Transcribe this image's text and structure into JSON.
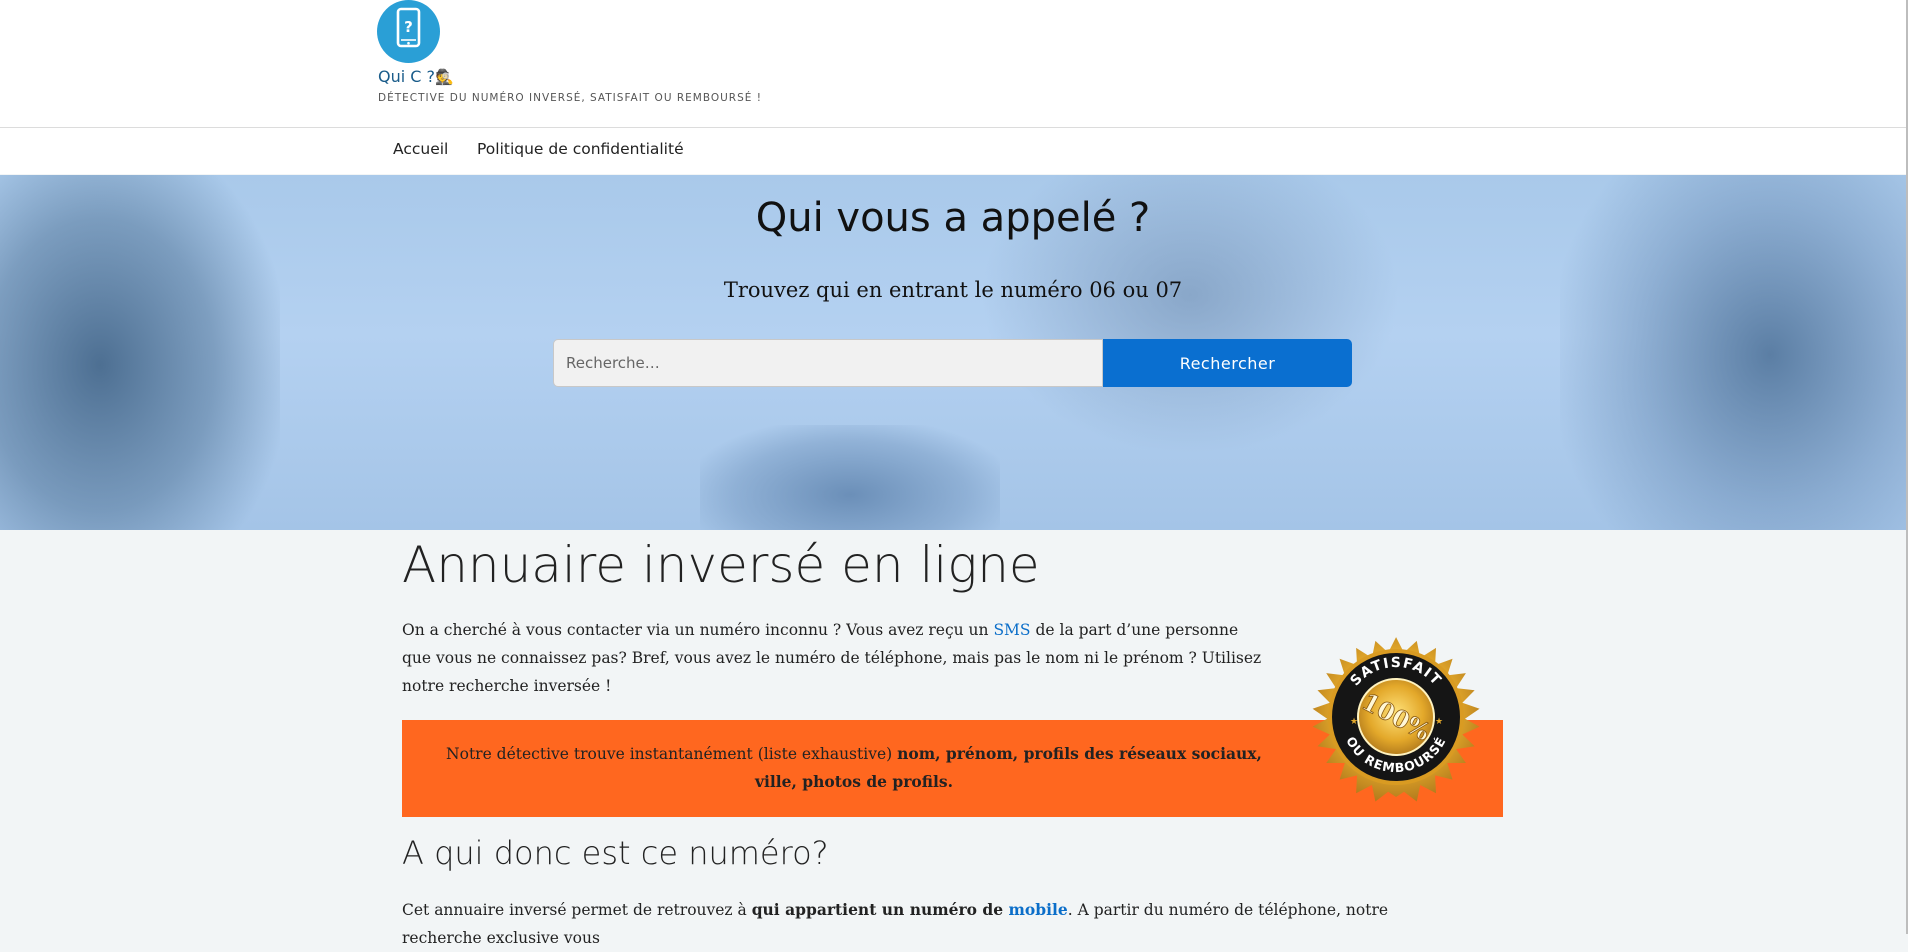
{
  "header": {
    "site_title": "Qui C ?",
    "site_title_emoji": "🕵",
    "tagline": "Détective du numéro inversé, satisfait ou remboursé !",
    "logo_icon": "phone-question-icon",
    "brand_color": "#2a9fd6"
  },
  "nav": {
    "items": [
      {
        "label": "Accueil"
      },
      {
        "label": "Politique de confidentialité"
      }
    ]
  },
  "hero": {
    "title": "Qui vous a appelé ?",
    "subtitle": "Trouvez qui en entrant le numéro 06 ou 07",
    "search": {
      "placeholder": "Recherche…",
      "value": "",
      "button_label": "Rechercher",
      "button_color": "#0a6fd0"
    }
  },
  "content": {
    "title": "Annuaire inversé en ligne",
    "intro": {
      "before_link": "On a cherché à vous contacter via un numéro inconnu ? Vous avez reçu un ",
      "link": "SMS",
      "after_link": " de la part d’une personne que vous ne connaissez pas? Bref, vous avez le numéro de téléphone, mais pas le nom ni le prénom ? Utilisez notre recherche inversée !"
    },
    "seal": {
      "top_text": "SATISFAIT",
      "bottom_text": "OU REMBOURSÉ",
      "center_text": "100%"
    },
    "highlight": {
      "normal": "Notre détective trouve instantanément (liste exhaustive) ",
      "bold": "nom, prénom, profils des réseaux sociaux, ville, photos de profils.",
      "bg_color": "#ff671f"
    },
    "section": {
      "title": "A qui donc est ce numéro?",
      "para_before": "Cet annuaire inversé permet de retrouvez à ",
      "para_bold": "qui appartient un numéro de ",
      "para_link": "mobile",
      "para_after": ". A partir du numéro de téléphone, notre recherche exclusive vous"
    }
  }
}
